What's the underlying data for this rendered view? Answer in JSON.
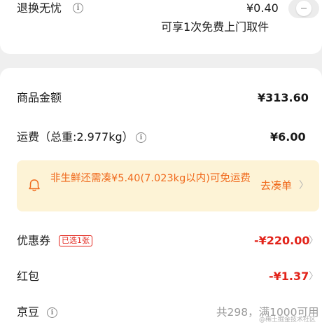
{
  "return_service": {
    "label": "退换无忧",
    "price": "¥0.40",
    "description": "可享1次免费上门取件"
  },
  "order_summary": {
    "goods_amount_label": "商品金额",
    "goods_amount_value": "¥313.60",
    "shipping_label": "运费（总重:2.977kg）",
    "shipping_value": "¥6.00",
    "promo_text": "非生鲜还需凑¥5.40(7.023kg以内)可免运费",
    "promo_action": "去凑单",
    "coupon_label": "优惠券",
    "coupon_badge": "已选1张",
    "coupon_value": "-¥220.00",
    "red_packet_label": "红包",
    "red_packet_value": "-¥1.37",
    "jd_beans_label": "京豆",
    "jd_beans_value": "共298，满1000可用"
  },
  "watermark": "@稀土掘金技术社区",
  "colors": {
    "accent_red": "#e2231a",
    "promo_orange": "#f06a1d",
    "promo_bg": "#fdf3d6"
  },
  "icons": {
    "info": "info-icon",
    "bell": "bell-icon",
    "chevron": "chevron-right-icon",
    "toggle": "toggle-switch"
  }
}
